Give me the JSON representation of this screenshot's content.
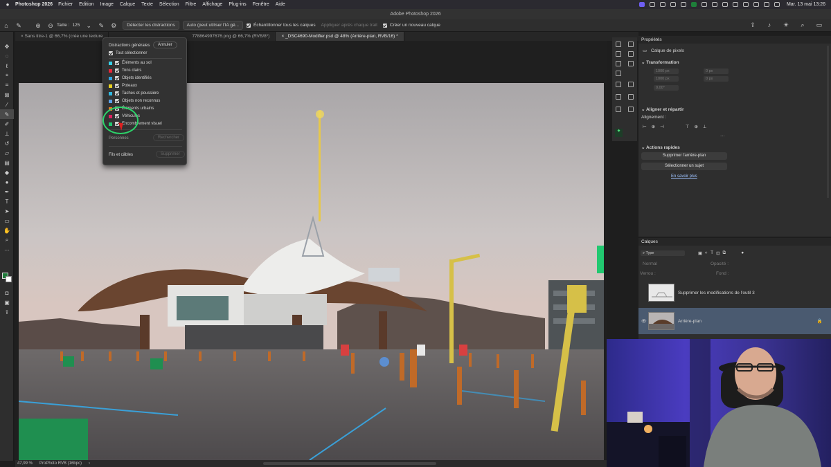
{
  "menubar": {
    "app_name": "Photoshop 2026",
    "items": [
      "Fichier",
      "Edition",
      "Image",
      "Calque",
      "Texte",
      "Sélection",
      "Filtre",
      "Affichage",
      "Plug-ins",
      "Fenêtre",
      "Aide"
    ],
    "clock": "Mar. 13 mai 13:26"
  },
  "window_title": "Adobe Photoshop 2026",
  "options_bar": {
    "size_label": "Taille :",
    "size_value": "125",
    "detect_button": "Détecter les distractions",
    "auto_dropdown": "Auto (peut utiliser l'IA gé...",
    "sample_all_layers": "Échantillonner tous les calques",
    "reapply_each_stroke": "Appliquer après chaque trait",
    "create_new_layer": "Créer un nouveau calque"
  },
  "tabs": [
    "Sans titre-1 @ 66,7% (crée une texture",
    "778864997676.png @ 66,7% (RVB/8*)",
    "_DSC4690-Modifier.psd @ 48% (Arrière-plan, RVB/16) *"
  ],
  "distractions_panel": {
    "general_label": "Distractions générales",
    "cancel_button": "Annuler",
    "select_all": "Tout sélectionner",
    "items": [
      {
        "label": "Éléments au sol",
        "color": "#38d0e8"
      },
      {
        "label": "Tons clairs",
        "color": "#e8263a"
      },
      {
        "label": "Objets identifiés",
        "color": "#2fa4e0"
      },
      {
        "label": "Poteaux",
        "color": "#e8d020"
      },
      {
        "label": "Taches et poussière",
        "color": "#2fb8e0"
      },
      {
        "label": "Objets non reconnus",
        "color": "#5aa0e8"
      },
      {
        "label": "Éléments urbains",
        "color": "#e87a20"
      },
      {
        "label": "Véhicules",
        "color": "#e02060"
      },
      {
        "label": "Encombrement visuel",
        "color": "#20c870"
      }
    ],
    "people_label": "Personnes",
    "search_button": "Rechercher",
    "wires_label": "Fils et câbles",
    "remove_button": "Supprimer"
  },
  "status_bar": {
    "zoom": "47,99 %",
    "profile": "ProPhoto RVB (16bpc)"
  },
  "properties": {
    "title": "Propriétés",
    "layer_kind": "Calque de pixels",
    "transform_title": "Transformation",
    "fields": [
      "1000 px",
      "1000 px",
      "0 px",
      "0 px",
      "0,00°"
    ],
    "align_title": "Aligner et répartir",
    "alignment_label": "Alignement :",
    "quick_actions_title": "Actions rapides",
    "remove_bg_button": "Supprimer l'arrière-plan",
    "select_subject_button": "Sélectionner un sujet",
    "learn_more": "En savoir plus"
  },
  "layers": {
    "title": "Calques",
    "filter_kind": "Type",
    "blend_mode": "Normal",
    "opacity_label": "Opacité :",
    "lock_label": "Verrou :",
    "fill_label": "Fond :",
    "items": [
      {
        "name": "Supprimer les modifications de l'outil 3",
        "selected": false
      },
      {
        "name": "Arrière-plan",
        "selected": true
      }
    ]
  }
}
